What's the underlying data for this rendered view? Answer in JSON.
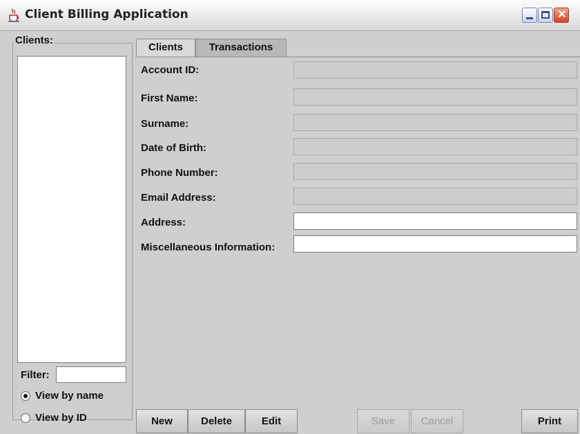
{
  "window": {
    "title": "Client Billing Application"
  },
  "clients_panel": {
    "group_label": "Clients:",
    "filter_label": "Filter:",
    "filter_value": "",
    "view_options": [
      {
        "label": "View by name",
        "selected": true
      },
      {
        "label": "View by ID",
        "selected": false
      }
    ]
  },
  "tabs": [
    {
      "label": "Clients",
      "active": true
    },
    {
      "label": "Transactions",
      "active": false
    }
  ],
  "form": {
    "fields": [
      {
        "label": "Account ID:",
        "value": "",
        "editable": false
      },
      {
        "label": "First Name:",
        "value": "",
        "editable": false
      },
      {
        "label": "Surname:",
        "value": "",
        "editable": false
      },
      {
        "label": "Date of Birth:",
        "value": "",
        "editable": false
      },
      {
        "label": "Phone Number:",
        "value": "",
        "editable": false
      },
      {
        "label": "Email Address:",
        "value": "",
        "editable": false
      },
      {
        "label": "Address:",
        "value": "",
        "editable": true
      },
      {
        "label": "Miscellaneous Information:",
        "value": "",
        "editable": true
      }
    ]
  },
  "buttons": {
    "new": "New",
    "delete": "Delete",
    "edit": "Edit",
    "save": "Save",
    "cancel": "Cancel",
    "print": "Print"
  }
}
